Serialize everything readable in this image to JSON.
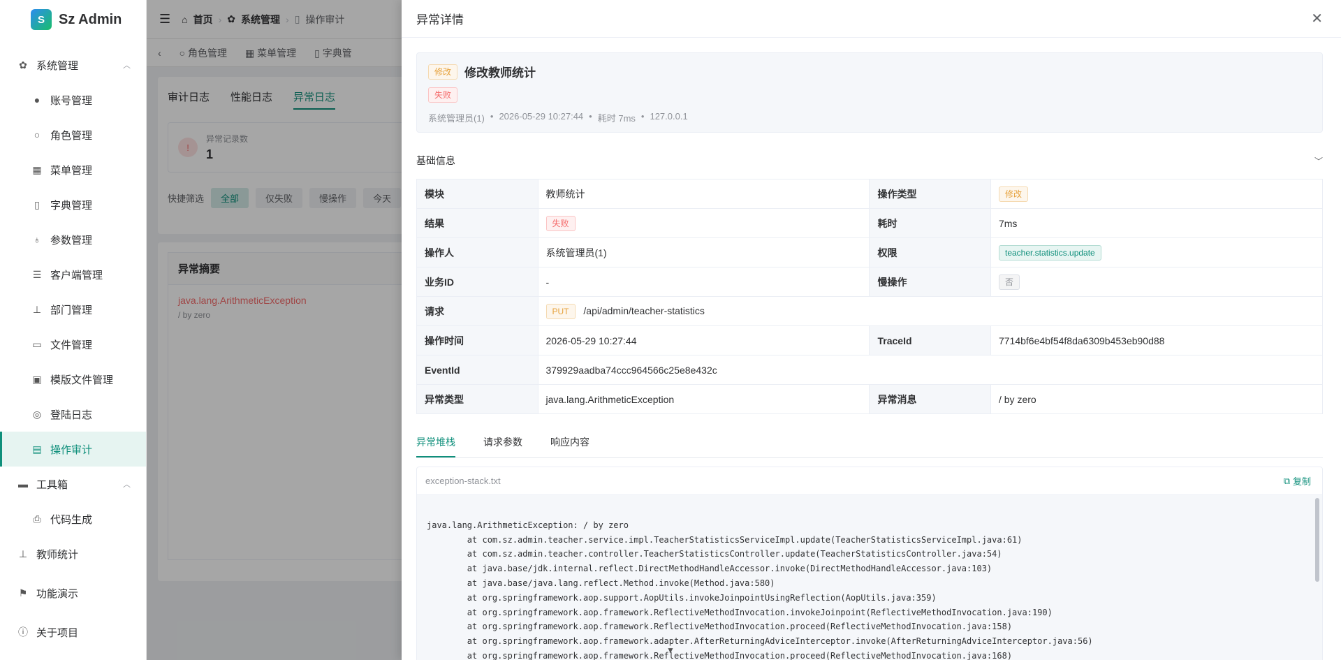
{
  "app": {
    "logo_mark": "S",
    "name": "Sz Admin"
  },
  "sidebar": {
    "groups": [
      {
        "label": "系统管理",
        "icon": "gear-icon"
      },
      {
        "label": "工具箱",
        "icon": "toolbox-icon"
      }
    ],
    "items": [
      {
        "label": "账号管理",
        "icon": "user-icon"
      },
      {
        "label": "角色管理",
        "icon": "person-outline-icon"
      },
      {
        "label": "菜单管理",
        "icon": "grid-icon"
      },
      {
        "label": "字典管理",
        "icon": "book-icon"
      },
      {
        "label": "参数管理",
        "icon": "flask-icon"
      },
      {
        "label": "客户端管理",
        "icon": "sliders-icon"
      },
      {
        "label": "部门管理",
        "icon": "org-icon"
      },
      {
        "label": "文件管理",
        "icon": "briefcase-icon"
      },
      {
        "label": "模版文件管理",
        "icon": "template-icon"
      },
      {
        "label": "登陆日志",
        "icon": "location-icon"
      },
      {
        "label": "操作审计",
        "icon": "audit-icon"
      }
    ],
    "tool_items": [
      {
        "label": "代码生成",
        "icon": "printer-icon"
      }
    ],
    "bottom_items": [
      {
        "label": "教师统计",
        "icon": "chart-org-icon"
      },
      {
        "label": "功能演示",
        "icon": "flag-icon"
      },
      {
        "label": "关于项目",
        "icon": "info-icon"
      }
    ]
  },
  "header": {
    "breadcrumb": [
      "首页",
      "系统管理",
      "操作审计"
    ]
  },
  "tabsbar": {
    "tabs": [
      "角色管理",
      "菜单管理",
      "字典管"
    ]
  },
  "main": {
    "log_tabs": [
      "审计日志",
      "性能日志",
      "异常日志"
    ],
    "stat_label": "异常记录数",
    "stat_value": "1",
    "quick_label": "快捷筛选",
    "chips": [
      "全部",
      "仅失败",
      "慢操作",
      "今天"
    ],
    "list_title": "异常摘要",
    "list_item": {
      "exception": "java.lang.ArithmeticException",
      "message": "/ by zero"
    }
  },
  "drawer": {
    "title": "异常详情",
    "summary": {
      "op_tag": "修改",
      "name": "修改教师统计",
      "status_tag": "失败",
      "meta": [
        "系统管理员(1)",
        "•",
        "2026-05-29 10:27:44",
        "•",
        "耗时 7ms",
        "•",
        "127.0.0.1"
      ]
    },
    "section_title": "基础信息",
    "desc": {
      "module_label": "模块",
      "module": "教师统计",
      "optype_label": "操作类型",
      "optype": "修改",
      "result_label": "结果",
      "result": "失败",
      "cost_label": "耗时",
      "cost": "7ms",
      "operator_label": "操作人",
      "operator": "系统管理员(1)",
      "perm_label": "权限",
      "perm": "teacher.statistics.update",
      "bizid_label": "业务ID",
      "bizid": "-",
      "slow_label": "慢操作",
      "slow": "否",
      "request_label": "请求",
      "method": "PUT",
      "path": "/api/admin/teacher-statistics",
      "time_label": "操作时间",
      "time": "2026-05-29 10:27:44",
      "trace_label": "TraceId",
      "trace": "7714bf6e4bf54f8da6309b453eb90d88",
      "event_label": "EventId",
      "event": "379929aadba74ccc964566c25e8e432c",
      "extype_label": "异常类型",
      "extype": "java.lang.ArithmeticException",
      "exmsg_label": "异常消息",
      "exmsg": "/ by zero"
    },
    "detail_tabs": [
      "异常堆栈",
      "请求参数",
      "响应内容"
    ],
    "code": {
      "filename": "exception-stack.txt",
      "copy_label": "复制",
      "lines": [
        "java.lang.ArithmeticException: / by zero",
        "        at com.sz.admin.teacher.service.impl.TeacherStatisticsServiceImpl.update(TeacherStatisticsServiceImpl.java:61)",
        "        at com.sz.admin.teacher.controller.TeacherStatisticsController.update(TeacherStatisticsController.java:54)",
        "        at java.base/jdk.internal.reflect.DirectMethodHandleAccessor.invoke(DirectMethodHandleAccessor.java:103)",
        "        at java.base/java.lang.reflect.Method.invoke(Method.java:580)",
        "        at org.springframework.aop.support.AopUtils.invokeJoinpointUsingReflection(AopUtils.java:359)",
        "        at org.springframework.aop.framework.ReflectiveMethodInvocation.invokeJoinpoint(ReflectiveMethodInvocation.java:190)",
        "        at org.springframework.aop.framework.ReflectiveMethodInvocation.proceed(ReflectiveMethodInvocation.java:158)",
        "        at org.springframework.aop.framework.adapter.AfterReturningAdviceInterceptor.invoke(AfterReturningAdviceInterceptor.java:56)",
        "        at org.springframework.aop.framework.ReflectiveMethodInvocation.proceed(ReflectiveMethodInvocation.java:168)"
      ]
    }
  },
  "colors": {
    "accent": "#0f8f7b",
    "danger": "#f56c6c",
    "warning": "#e6a23c"
  }
}
